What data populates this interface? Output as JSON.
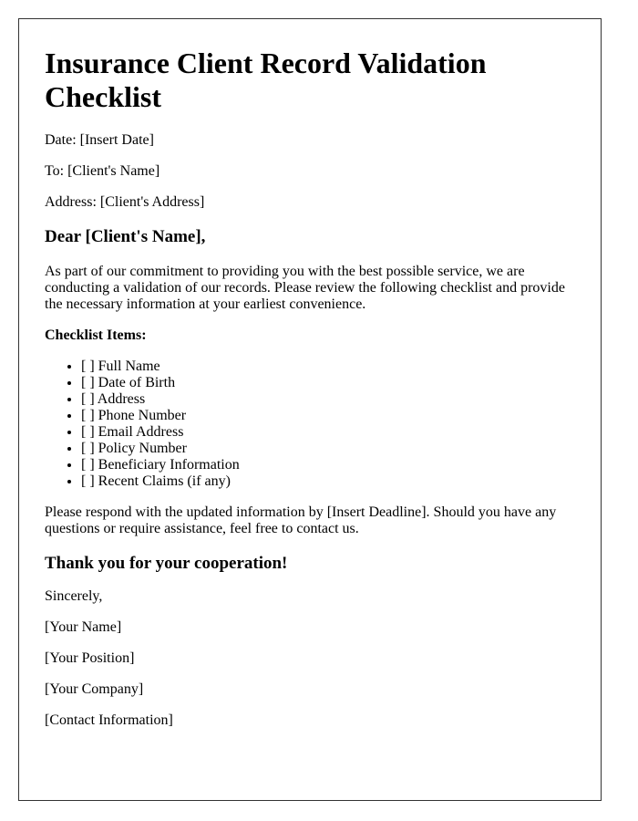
{
  "document": {
    "title": "Insurance Client Record Validation Checklist",
    "date_line": "Date: [Insert Date]",
    "to_line": "To: [Client's Name]",
    "address_line": "Address: [Client's Address]",
    "greeting": "Dear [Client's Name],",
    "intro": "As part of our commitment to providing you with the best possible service, we are conducting a validation of our records. Please review the following checklist and provide the necessary information at your earliest convenience.",
    "checklist_heading": "Checklist Items:",
    "checklist_items": [
      "[ ] Full Name",
      "[ ] Date of Birth",
      "[ ] Address",
      "[ ] Phone Number",
      "[ ] Email Address",
      "[ ] Policy Number",
      "[ ] Beneficiary Information",
      "[ ] Recent Claims (if any)"
    ],
    "closing_paragraph": "Please respond with the updated information by [Insert Deadline]. Should you have any questions or require assistance, feel free to contact us.",
    "thanks": "Thank you for your cooperation!",
    "signoff": "Sincerely,",
    "signature": {
      "name": "[Your Name]",
      "position": "[Your Position]",
      "company": "[Your Company]",
      "contact": "[Contact Information]"
    }
  }
}
